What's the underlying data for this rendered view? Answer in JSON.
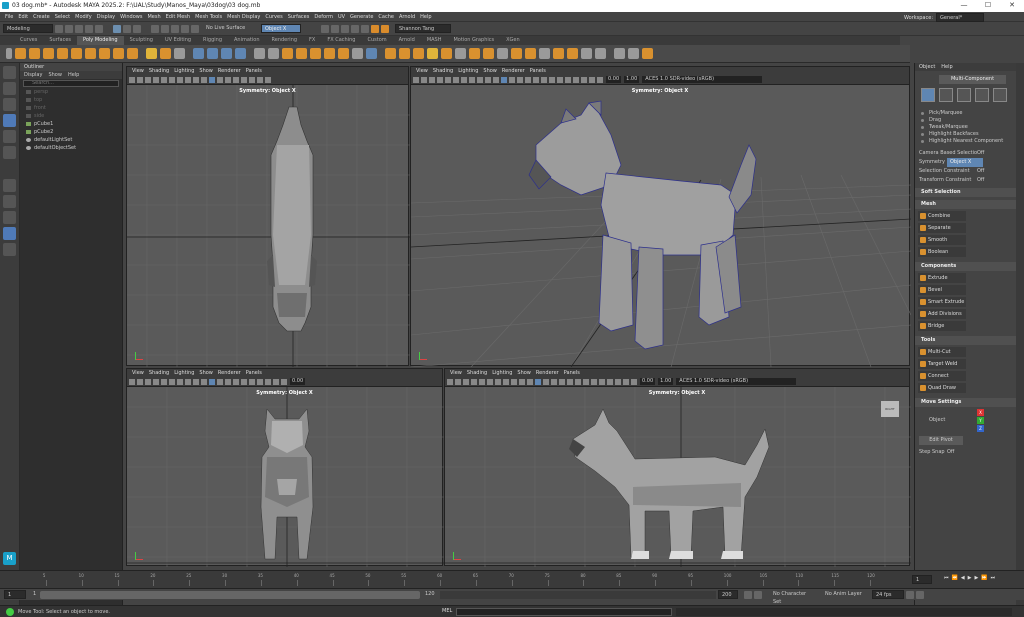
{
  "window": {
    "title": "03 dog.mb* - Autodesk MAYA 2025.2: F:\\UAL\\Study\\Manos_Maya\\03dog\\03 dog.mb",
    "min": "—",
    "max": "☐",
    "close": "✕"
  },
  "menus": [
    "File",
    "Edit",
    "Create",
    "Select",
    "Modify",
    "Display",
    "Windows",
    "Mesh",
    "Edit Mesh",
    "Mesh Tools",
    "Mesh Display",
    "Curves",
    "Surfaces",
    "Deform",
    "UV",
    "Generate",
    "Cache",
    "Arnold",
    "Help"
  ],
  "workspace": {
    "label": "Workspace:",
    "value": "General*"
  },
  "status": {
    "mode": "Modeling",
    "live_surface": "No Live Surface",
    "symmetry": "Object X",
    "user": "Shannon Tang"
  },
  "shelf_tabs": [
    "Curves",
    "Surfaces",
    "Poly Modeling",
    "Sculpting",
    "UV Editing",
    "Rigging",
    "Animation",
    "Rendering",
    "FX",
    "FX Caching",
    "Custom",
    "Arnold",
    "MASH",
    "Motion Graphics",
    "XGen"
  ],
  "shelf_active": 2,
  "outliner": {
    "title": "Outliner",
    "menu": [
      "Display",
      "Show",
      "Help"
    ],
    "search": "Search...",
    "items": [
      {
        "label": "persp",
        "dim": true
      },
      {
        "label": "top",
        "dim": true
      },
      {
        "label": "front",
        "dim": true
      },
      {
        "label": "side",
        "dim": true
      },
      {
        "label": "pCube1",
        "dim": false
      },
      {
        "label": "pCube2",
        "dim": false
      },
      {
        "label": "defaultLightSet",
        "dim": false
      },
      {
        "label": "defaultObjectSet",
        "dim": false
      }
    ]
  },
  "viewport_menu": [
    "View",
    "Shading",
    "Lighting",
    "Show",
    "Renderer",
    "Panels"
  ],
  "viewports": {
    "top": {
      "symmetry": "Symmetry: Object X"
    },
    "persp": {
      "symmetry": "Symmetry: Object X",
      "near": "0.00",
      "far": "1.00",
      "color": "ACES 1.0 SDR-video (sRGB)"
    },
    "front": {
      "symmetry": "Symmetry: Object X",
      "near": "0.00"
    },
    "side": {
      "symmetry": "Symmetry: Object X",
      "near": "0.00",
      "far": "1.00",
      "color": "ACES 1.0 SDR-video (sRGB)",
      "cube": "RIGHT"
    }
  },
  "modeling_toolkit": {
    "tabs": [
      "Object",
      "Help"
    ],
    "multi_component": "Multi-Component",
    "selection_options": [
      "Pick/Marquee",
      "Drag",
      "Tweak/Marquee",
      "Highlight Backfaces",
      "Highlight Nearest Component"
    ],
    "camera_based": {
      "label": "Camera Based Selection",
      "value": "Off"
    },
    "symmetry": {
      "label": "Symmetry",
      "value": "Object X"
    },
    "selection_constraint": {
      "label": "Selection Constraint",
      "value": "Off"
    },
    "transform_constraint": {
      "label": "Transform Constraint",
      "value": "Off"
    },
    "soft_selection": "Soft Selection",
    "mesh": {
      "title": "Mesh",
      "buttons": [
        "Combine",
        "Separate",
        "Smooth",
        "Boolean"
      ]
    },
    "components": {
      "title": "Components",
      "buttons": [
        "Extrude",
        "Bevel",
        "Smart Extrude",
        "Add Divisions",
        "Bridge"
      ]
    },
    "tools": {
      "title": "Tools",
      "buttons": [
        "Multi-Cut",
        "Target Weld",
        "Connect",
        "Quad Draw"
      ]
    },
    "move_settings": "Move Settings",
    "object": "Object",
    "edit_pivot": "Edit Pivot",
    "step_snap": {
      "label": "Step Snap",
      "value": "Off"
    },
    "axis_labels": [
      "X",
      "Y",
      "Z"
    ]
  },
  "timeline": {
    "ticks": [
      "5",
      "10",
      "15",
      "20",
      "25",
      "30",
      "35",
      "40",
      "45",
      "50",
      "55",
      "60",
      "65",
      "70",
      "75",
      "80",
      "85",
      "90",
      "95",
      "100",
      "105",
      "110",
      "115",
      "120"
    ],
    "current_frame": "1",
    "range_start": "1",
    "range_start2": "1",
    "range_end": "120",
    "range_end2": "120",
    "range_end3": "200",
    "character_set": "No Character Set",
    "anim_layer": "No Anim Layer",
    "fps": "24 fps"
  },
  "help_line": {
    "text": "Move Tool: Select an object to move.",
    "mel": "MEL"
  }
}
